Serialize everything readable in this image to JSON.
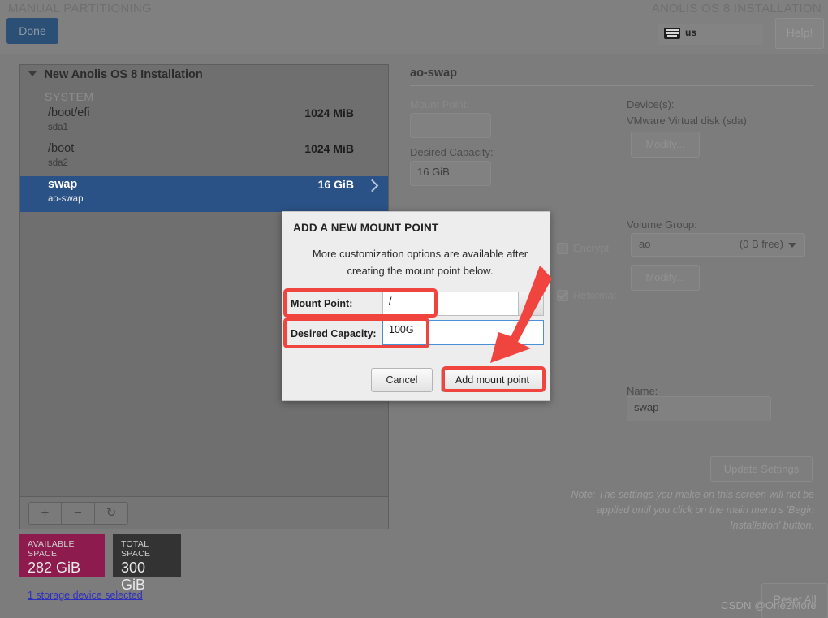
{
  "header": {
    "left_title": "MANUAL PARTITIONING",
    "right_title": "ANOLIS OS 8 INSTALLATION",
    "done_label": "Done",
    "keyboard_layout": "us",
    "keyboard_icon": "keyboard-icon",
    "help_label": "Help!"
  },
  "left_panel": {
    "root_label": "New Anolis OS 8 Installation",
    "group_label": "SYSTEM",
    "partitions": [
      {
        "mount": "/boot/efi",
        "device": "sda1",
        "size": "1024 MiB",
        "selected": false
      },
      {
        "mount": "/boot",
        "device": "sda2",
        "size": "1024 MiB",
        "selected": false
      },
      {
        "mount": "swap",
        "device": "ao-swap",
        "size": "16 GiB",
        "selected": true
      }
    ],
    "toolbar": {
      "add_label": "+",
      "remove_label": "−",
      "refresh_label": "↻"
    },
    "available_space_caption": "AVAILABLE SPACE",
    "available_space_value": "282 GiB",
    "total_space_caption": "TOTAL SPACE",
    "total_space_value": "300 GiB",
    "storage_link": "1 storage device selected"
  },
  "right_panel": {
    "title": "ao-swap",
    "mount_point_label": "Mount Point:",
    "mount_point_value": "",
    "desired_capacity_label": "Desired Capacity:",
    "desired_capacity_value": "16 GiB",
    "devices_label": "Device(s):",
    "devices_value": "VMware Virtual disk (sda)",
    "modify_devices_label": "Modify...",
    "volume_group_label": "Volume Group:",
    "volume_group_value": "ao",
    "volume_group_free": "(0 B free)",
    "modify_vg_label": "Modify...",
    "encrypt_label": "Encrypt",
    "reformat_label": "Reformat",
    "name_label": "Name:",
    "name_value": "swap",
    "update_settings_label": "Update Settings",
    "note": "Note:  The settings you make on this screen will not be applied until you click on the main menu's 'Begin Installation' button.",
    "reset_all_label": "Reset All"
  },
  "dialog": {
    "title": "ADD A NEW MOUNT POINT",
    "description": "More customization options are available after creating the mount point below.",
    "mount_point_label": "Mount Point:",
    "mount_point_value": "/",
    "desired_capacity_label": "Desired Capacity:",
    "desired_capacity_value": "100G",
    "cancel_label": "Cancel",
    "add_label": "Add mount point"
  },
  "watermark": "CSDN @One2More",
  "colors": {
    "accent_blue": "#2b5286",
    "done_blue": "#2c4f76",
    "available_space": "#8d1b4d",
    "total_space": "#333333",
    "annotation_red": "#f0453f",
    "link_blue": "#2f2fbf"
  }
}
